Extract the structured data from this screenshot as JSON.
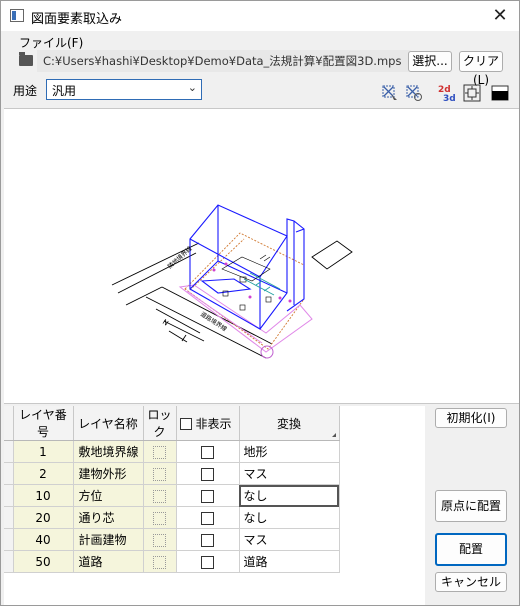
{
  "window": {
    "title": "図面要素取込み"
  },
  "file": {
    "label": "ファイル(F)",
    "path": "C:¥Users¥hashi¥Desktop¥Demo¥Data_法規計算¥配置図3D.mps",
    "select_button": "選択...",
    "clear_button": "クリア(L)"
  },
  "usage": {
    "label": "用途",
    "selected": "汎用"
  },
  "toolbar": {
    "icons": [
      "select-all-icon",
      "deselect-icon",
      "2d-3d-toggle-icon",
      "fit-view-icon",
      "background-color-icon"
    ],
    "icon_2d_label": "2d",
    "icon_3d_label": "3d"
  },
  "preview": {
    "labels": [
      "隣地境界線",
      "道路境界線",
      "N"
    ]
  },
  "layer_table": {
    "headers": {
      "layer_no": "レイヤ番号",
      "layer_name": "レイヤ名称",
      "lock": "ロック",
      "hide": "非表示",
      "convert": "変換"
    },
    "rows": [
      {
        "no": "1",
        "name": "敷地境界線",
        "convert": "地形"
      },
      {
        "no": "2",
        "name": "建物外形",
        "convert": "マス"
      },
      {
        "no": "10",
        "name": "方位",
        "convert": "なし"
      },
      {
        "no": "20",
        "name": "通り芯",
        "convert": "なし"
      },
      {
        "no": "40",
        "name": "計画建物",
        "convert": "マス"
      },
      {
        "no": "50",
        "name": "道路",
        "convert": "道路"
      }
    ]
  },
  "buttons": {
    "reset": "初期化(I)",
    "place_origin": "原点に配置",
    "place": "配置",
    "cancel": "キャンセル"
  },
  "colors": {
    "accent": "#0067c0",
    "model_blue": "#1a1aff",
    "site_orange": "#d07830",
    "road_pink": "#e088e8",
    "cell_beige": "#f5f5dc"
  }
}
